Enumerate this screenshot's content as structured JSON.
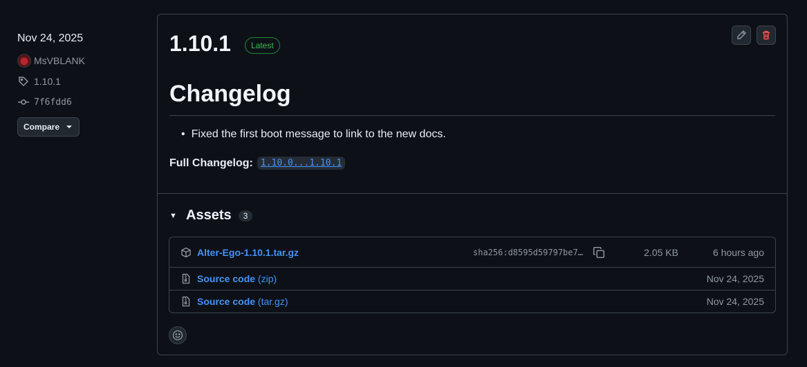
{
  "meta": {
    "date": "Nov 24, 2025",
    "author": "MsVBLANK",
    "tag": "1.10.1",
    "commit": "7f6fdd6",
    "compare_label": "Compare"
  },
  "release": {
    "title": "1.10.1",
    "badge": "Latest",
    "changelog_heading": "Changelog",
    "bullets": [
      "Fixed the first boot message to link to the new docs."
    ],
    "full_changelog_label": "Full Changelog:",
    "full_changelog_link": "1.10.0...1.10.1"
  },
  "assets": {
    "title": "Assets",
    "count": "3",
    "items": [
      {
        "name": "Alter-Ego-1.10.1.tar.gz",
        "sub": "",
        "sha": "sha256:d8595d59797be7…",
        "size": "2.05 KB",
        "date": "6 hours ago",
        "icon": "package-icon"
      },
      {
        "name": "Source code",
        "sub": "(zip)",
        "sha": "",
        "size": "",
        "date": "Nov 24, 2025",
        "icon": "file-zip-icon"
      },
      {
        "name": "Source code",
        "sub": "(tar.gz)",
        "sha": "",
        "size": "",
        "date": "Nov 24, 2025",
        "icon": "file-zip-icon"
      }
    ]
  },
  "colors": {
    "accent": "#4493f8",
    "latest": "#3fb950",
    "danger": "#f85149"
  }
}
